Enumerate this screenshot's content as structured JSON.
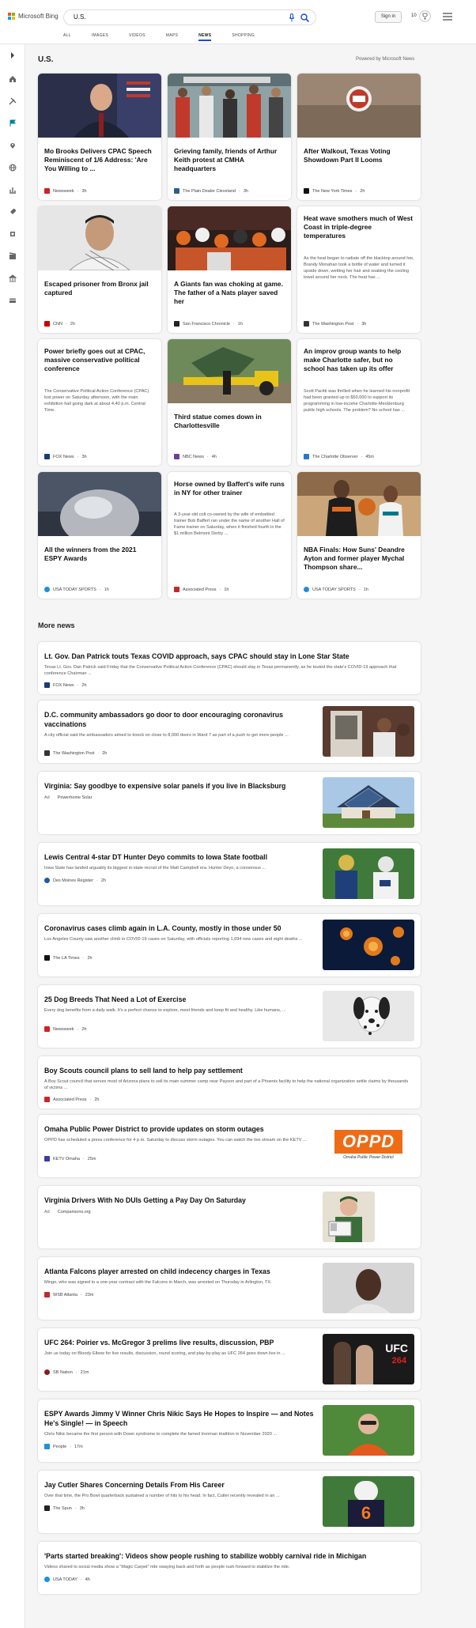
{
  "header": {
    "logo_text": "Microsoft Bing",
    "search_value": "U.S.",
    "signin_label": "Sign in",
    "points": "10"
  },
  "nav": [
    "ALL",
    "IMAGES",
    "VIDEOS",
    "MAPS",
    "NEWS",
    "SHOPPING"
  ],
  "nav_active": "NEWS",
  "section": {
    "title": "U.S.",
    "powered_by": "Powered by Microsoft News"
  },
  "cards": [
    {
      "title": "Mo Brooks Delivers CPAC Speech Reminiscent of 1/6 Address: 'Are You Willing to ...",
      "excerpt": "",
      "source": "Newsweek",
      "time": "3h",
      "logo_color": "#d32020"
    },
    {
      "title": "Grieving family, friends of Arthur Keith protest at CMHA headquarters",
      "excerpt": "",
      "source": "The Plain Dealer Cleveland",
      "time": "3h",
      "logo_color": "#2f5d8a"
    },
    {
      "title": "After Walkout, Texas Voting Showdown Part II Looms",
      "excerpt": "",
      "source": "The New York Times",
      "time": "2h",
      "logo_color": "#111111"
    },
    {
      "title": "Escaped prisoner from Bronx jail captured",
      "excerpt": "",
      "source": "CNN",
      "time": "2h",
      "logo_color": "#cc0000"
    },
    {
      "title": "A Giants fan was choking at game. The father of a Nats player saved her",
      "excerpt": "",
      "source": "San Francisco Chronicle",
      "time": "1h",
      "logo_color": "#222222"
    },
    {
      "title": "Heat wave smothers much of West Coast in triple-degree temperatures",
      "excerpt": "As the heat began to radiate off the blacktop around her, Brandy Monahan took a bottle of water and turned it upside down, wetting her hair and soaking the cooling towel around her neck. The heat has ...",
      "source": "The Washington Post",
      "time": "3h",
      "logo_color": "#333333"
    },
    {
      "title": "Power briefly goes out at CPAC, massive conservative political conference",
      "excerpt": "The Conservative Political Action Conference (CPAC) lost power on Saturday afternoon, with the main exhibition hall going dark at about 4:40 p.m. Central Time.",
      "source": "FOX News",
      "time": "3h",
      "logo_color": "#1b3a7a"
    },
    {
      "title": "Third statue comes down in Charlottesville",
      "excerpt": "",
      "source": "NBC News",
      "time": "4h",
      "logo_color": "#6b3fa0"
    },
    {
      "title": "An improv group wants to help make Charlotte safer, but no school has taken up its offer",
      "excerpt": "Scott Pacitti was thrilled when he learned his nonprofit had been granted up to $50,000 to support its programming in low-income Charlotte-Mecklenburg public high schools. The problem? No school has ...",
      "source": "The Charlotte Observer",
      "time": "45m",
      "logo_color": "#2a78c8"
    },
    {
      "title": "All the winners from the 2021 ESPY Awards",
      "excerpt": "",
      "source": "USA TODAY SPORTS",
      "time": "1h",
      "logo_color": "#1a8fe3"
    },
    {
      "title": "Horse owned by Baffert's wife runs in NY for other trainer",
      "excerpt": "A 3-year-old colt co-owned by the wife of embattled trainer Bob Baffert ran under the name of another Hall of Fame trainer on Saturday, when it finished fourth in the $1 million Belmont Derby ...",
      "source": "Associated Press",
      "time": "1h",
      "logo_color": "#c62828"
    },
    {
      "title": "NBA Finals: How Suns' Deandre Ayton and former player Mychal Thompson share...",
      "excerpt": "",
      "source": "USA TODAY SPORTS",
      "time": "1h",
      "logo_color": "#1a8fe3"
    }
  ],
  "more_news_title": "More news",
  "rows": [
    {
      "title": "Lt. Gov. Dan Patrick touts Texas COVID approach, says CPAC should stay in Lone Star State",
      "excerpt": "Texas Lt. Gov. Dan Patrick said Friday that the Conservative Political Action Conference (CPAC) should stay in Texas permanently, as he touted the state's COVID-19 approach that conference Chairman ...",
      "source": "FOX News",
      "time": "2h",
      "ad": "",
      "logo_color": "#1b3a7a"
    },
    {
      "title": "D.C. community ambassadors go door to door encouraging coronavirus vaccinations",
      "excerpt": "A city official said the ambassadors aimed to knock on close to 8,000 doors in Ward 7 as part of a push to get more people ...",
      "source": "The Washington Post",
      "time": "2h",
      "ad": "",
      "logo_color": "#333333"
    },
    {
      "title": "Virginia: Say goodbye to expensive solar panels if you live in Blacksburg",
      "excerpt": "",
      "source": "Powerhome Solar",
      "time": "",
      "ad": "Ad",
      "logo_color": ""
    },
    {
      "title": "Lewis Central 4-star DT Hunter Deyo commits to Iowa State football",
      "excerpt": "Iowa State has landed arguably its biggest in-state recruit of the Matt Campbell era. Hunter Deyo, a consensus ...",
      "source": "Des Moines Register",
      "time": "2h",
      "ad": "",
      "logo_color": "#1f5aa6"
    },
    {
      "title": "Coronavirus cases climb again in L.A. County, mostly in those under 50",
      "excerpt": "Los Angeles County saw another climb in COVID-19 cases on Saturday, with officials reporting 1,094 new cases and eight deaths ...",
      "source": "The LA Times",
      "time": "2h",
      "ad": "",
      "logo_color": "#111111"
    },
    {
      "title": "25 Dog Breeds That Need a Lot of Exercise",
      "excerpt": "Every dog benefits from a daily walk. It's a perfect chance to explore, meet friends and keep fit and healthy. Like humans, ...",
      "source": "Newsweek",
      "time": "2h",
      "ad": "",
      "logo_color": "#d32020"
    },
    {
      "title": "Boy Scouts council plans to sell land to help pay settlement",
      "excerpt": "A Boy Scout council that serves most of Arizona plans to sell its main summer camp near Payson and part of a Phoenix facility to help the national organization settle claims by thousands of victims ...",
      "source": "Associated Press",
      "time": "2h",
      "ad": "",
      "logo_color": "#c62828"
    },
    {
      "title": "Omaha Public Power District to provide updates on storm outages",
      "excerpt": "OPPD has scheduled a press conference for 4 p.m. Saturday to discuss storm outages. You can watch the live stream on the KETV ...",
      "source": "KETV Omaha",
      "time": "25m",
      "ad": "",
      "logo_color": "#3a3aa8",
      "logo_title": "OPPD",
      "logo_sub": "Omaha Public Power District"
    },
    {
      "title": "Virginia Drivers With No DUIs Getting a Pay Day On Saturday",
      "excerpt": "",
      "source": "Comparisons.org",
      "time": "",
      "ad": "Ad",
      "logo_color": ""
    },
    {
      "title": "Atlanta Falcons player arrested on child indecency charges in Texas",
      "excerpt": "Mingo, who was signed to a one-year contract with the Falcons in March, was arrested on Thursday in Arlington, TX.",
      "source": "WSB Atlanta",
      "time": "23m",
      "ad": "",
      "logo_color": "#c62828"
    },
    {
      "title": "UFC 264: Poirier vs. McGregor 3 prelims live results, discussion, PBP",
      "excerpt": "Join us today on Bloody Elbow for live results, discussion, round scoring, and play-by-play as UFC 264 goes down live in ...",
      "source": "SB Nation",
      "time": "21m",
      "ad": "",
      "logo_color": "#8a1c1c",
      "img_brand": "UFC",
      "img_num": "264"
    },
    {
      "title": "ESPY Awards Jimmy V Winner Chris Nikic Says He Hopes to Inspire — and Notes He's Single! — in Speech",
      "excerpt": "Chris Nikic became the first person with Down syndrome to complete the famed Ironman triathlon in November 2020 ...",
      "source": "People",
      "time": "17m",
      "ad": "",
      "logo_color": "#1f8fe0"
    },
    {
      "title": "Jay Cutler Shares Concerning Details From His Career",
      "excerpt": "Over that time, the Pro Bowl quarterback sustained a number of hits to his head. In fact, Cutler recently revealed in an ...",
      "source": "The Spun",
      "time": "3h",
      "ad": "",
      "logo_color": "#222222",
      "jersey_number": "6"
    },
    {
      "title": "'Parts started breaking': Videos show people rushing to stabilize wobbly carnival ride in Michigan",
      "excerpt": "Videos shared to social media show a \"Magic Carpet\" ride swaying back and forth as people rush forward to stabilize the ride.",
      "source": "USA TODAY",
      "time": "4h",
      "ad": "",
      "logo_color": "#1a8fe3"
    }
  ],
  "colors": {
    "accent": "#174ae4",
    "bing_teal": "#00809d"
  }
}
